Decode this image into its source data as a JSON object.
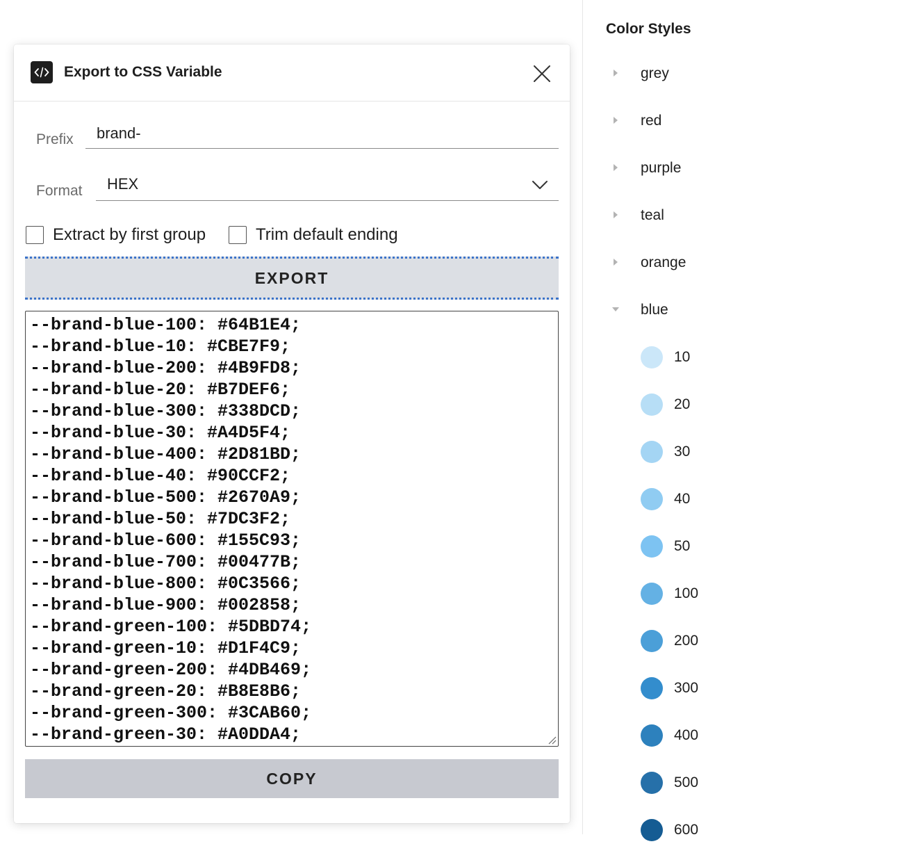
{
  "dialog": {
    "title": "Export to CSS Variable",
    "prefix_label": "Prefix",
    "prefix_value": "brand-",
    "format_label": "Format",
    "format_value": "HEX",
    "checkbox_extract_label": "Extract by first group",
    "checkbox_trim_label": "Trim default ending",
    "checkbox_extract_checked": false,
    "checkbox_trim_checked": false,
    "export_label": "EXPORT",
    "copy_label": "COPY",
    "code_lines": [
      "--brand-blue-100: #64B1E4;",
      "--brand-blue-10: #CBE7F9;",
      "--brand-blue-200: #4B9FD8;",
      "--brand-blue-20: #B7DEF6;",
      "--brand-blue-300: #338DCD;",
      "--brand-blue-30: #A4D5F4;",
      "--brand-blue-400: #2D81BD;",
      "--brand-blue-40: #90CCF2;",
      "--brand-blue-500: #2670A9;",
      "--brand-blue-50: #7DC3F2;",
      "--brand-blue-600: #155C93;",
      "--brand-blue-700: #00477B;",
      "--brand-blue-800: #0C3566;",
      "--brand-blue-900: #002858;",
      "--brand-green-100: #5DBD74;",
      "--brand-green-10: #D1F4C9;",
      "--brand-green-200: #4DB469;",
      "--brand-green-20: #B8E8B6;",
      "--brand-green-300: #3CAB60;",
      "--brand-green-30: #A0DDA4;"
    ],
    "icons": {
      "plugin": "code-icon",
      "close": "close-icon",
      "dropdown": "chevron-down-icon"
    }
  },
  "panel": {
    "title": "Color Styles",
    "groups": [
      {
        "name": "grey",
        "expanded": false
      },
      {
        "name": "red",
        "expanded": false
      },
      {
        "name": "purple",
        "expanded": false
      },
      {
        "name": "teal",
        "expanded": false
      },
      {
        "name": "orange",
        "expanded": false
      },
      {
        "name": "blue",
        "expanded": true
      }
    ],
    "blue_swatches": [
      {
        "label": "10",
        "color": "#CBE7F9"
      },
      {
        "label": "20",
        "color": "#B7DEF6"
      },
      {
        "label": "30",
        "color": "#A4D5F4"
      },
      {
        "label": "40",
        "color": "#90CCF2"
      },
      {
        "label": "50",
        "color": "#7DC3F2"
      },
      {
        "label": "100",
        "color": "#64B1E4"
      },
      {
        "label": "200",
        "color": "#4B9FD8"
      },
      {
        "label": "300",
        "color": "#338DCD"
      },
      {
        "label": "400",
        "color": "#2D81BD"
      },
      {
        "label": "500",
        "color": "#2670A9"
      },
      {
        "label": "600",
        "color": "#155C93"
      }
    ]
  },
  "colors": {
    "export_border": "#3b73c9",
    "export_bg": "#dcdfe4",
    "copy_bg": "#c7c9d0"
  }
}
